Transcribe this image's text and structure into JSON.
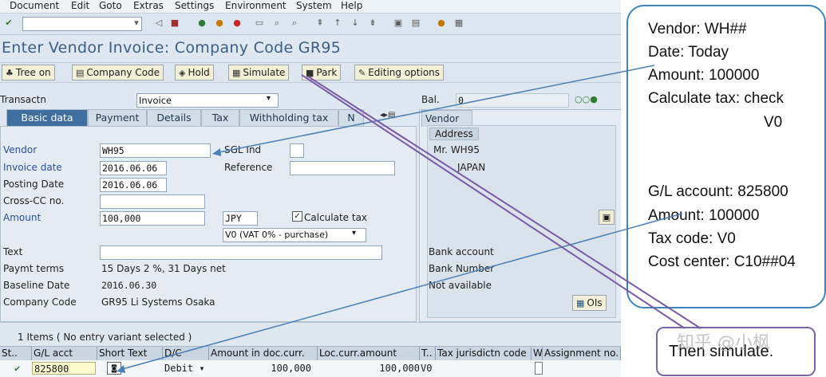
{
  "menu": [
    "Document",
    "Edit",
    "Goto",
    "Extras",
    "Settings",
    "Environment",
    "System",
    "Help"
  ],
  "title": "Enter Vendor Invoice: Company Code GR95",
  "app_buttons": {
    "tree_on": "Tree on",
    "company_code": "Company Code",
    "hold": "Hold",
    "simulate": "Simulate",
    "park": "Park",
    "editing_options": "Editing options"
  },
  "transaction": {
    "label": "Transactn",
    "value": "Invoice"
  },
  "balance": {
    "label": "Bal.",
    "value": "0"
  },
  "tabs": [
    "Basic data",
    "Payment",
    "Details",
    "Tax",
    "Withholding tax",
    "N"
  ],
  "form": {
    "vendor": {
      "label": "Vendor",
      "value": "WH95"
    },
    "sgl_ind": {
      "label": "SGL Ind"
    },
    "invoice_date": {
      "label": "Invoice date",
      "value": "2016.06.06"
    },
    "reference": {
      "label": "Reference"
    },
    "posting_date": {
      "label": "Posting Date",
      "value": "2016.06.06"
    },
    "cross_cc": {
      "label": "Cross-CC no."
    },
    "amount": {
      "label": "Amount",
      "value": "100,000",
      "currency": "JPY"
    },
    "calc_tax": {
      "label": "Calculate tax",
      "checked": true
    },
    "tax_code": "V0 (VAT 0% - purchase)",
    "text": {
      "label": "Text"
    },
    "paymt_terms": {
      "label": "Paymt terms",
      "value": "15 Days 2 %, 31 Days net"
    },
    "baseline_date": {
      "label": "Baseline Date",
      "value": "2016.06.30"
    },
    "company_code": {
      "label": "Company Code",
      "value": "GR95 Li Systems Osaka"
    }
  },
  "vendor_panel": {
    "tab": "Vendor",
    "address_label": "Address",
    "name": "Mr. WH95",
    "country": "JAPAN",
    "bank_account": "Bank account",
    "bank_number": "Bank Number",
    "not_available": "Not available",
    "ois": "OIs"
  },
  "items_status": "1 Items ( No entry variant selected )",
  "grid": {
    "headers": [
      "St..",
      "G/L acct",
      "Short Text",
      "D/C",
      "Amount in doc.curr.",
      "Loc.curr.amount",
      "T..",
      "Tax jurisdictn code",
      "W..",
      "Assignment no."
    ],
    "row": {
      "gl_acct": "825800",
      "dc": "Debit",
      "amount": "100,000",
      "loc_amount": "100,000",
      "tax": "V0"
    }
  },
  "callout": {
    "lines": [
      "Vendor: WH##",
      "Date: Today",
      "Amount: 100000",
      "Calculate tax: check",
      "V0",
      "G/L account: 825800",
      "Amount: 100000",
      "Tax code: V0",
      "Cost center: C10##04"
    ]
  },
  "simulate_note": "Then simulate.",
  "watermark": "知乎 @小枫",
  "colors": {
    "callout_border": "#3f84b9",
    "note_border": "#7c66a6",
    "arrow_blue": "#4a7fb8",
    "arrow_purple": "#7a5aa8",
    "active_tab": "#3f6f9f"
  }
}
